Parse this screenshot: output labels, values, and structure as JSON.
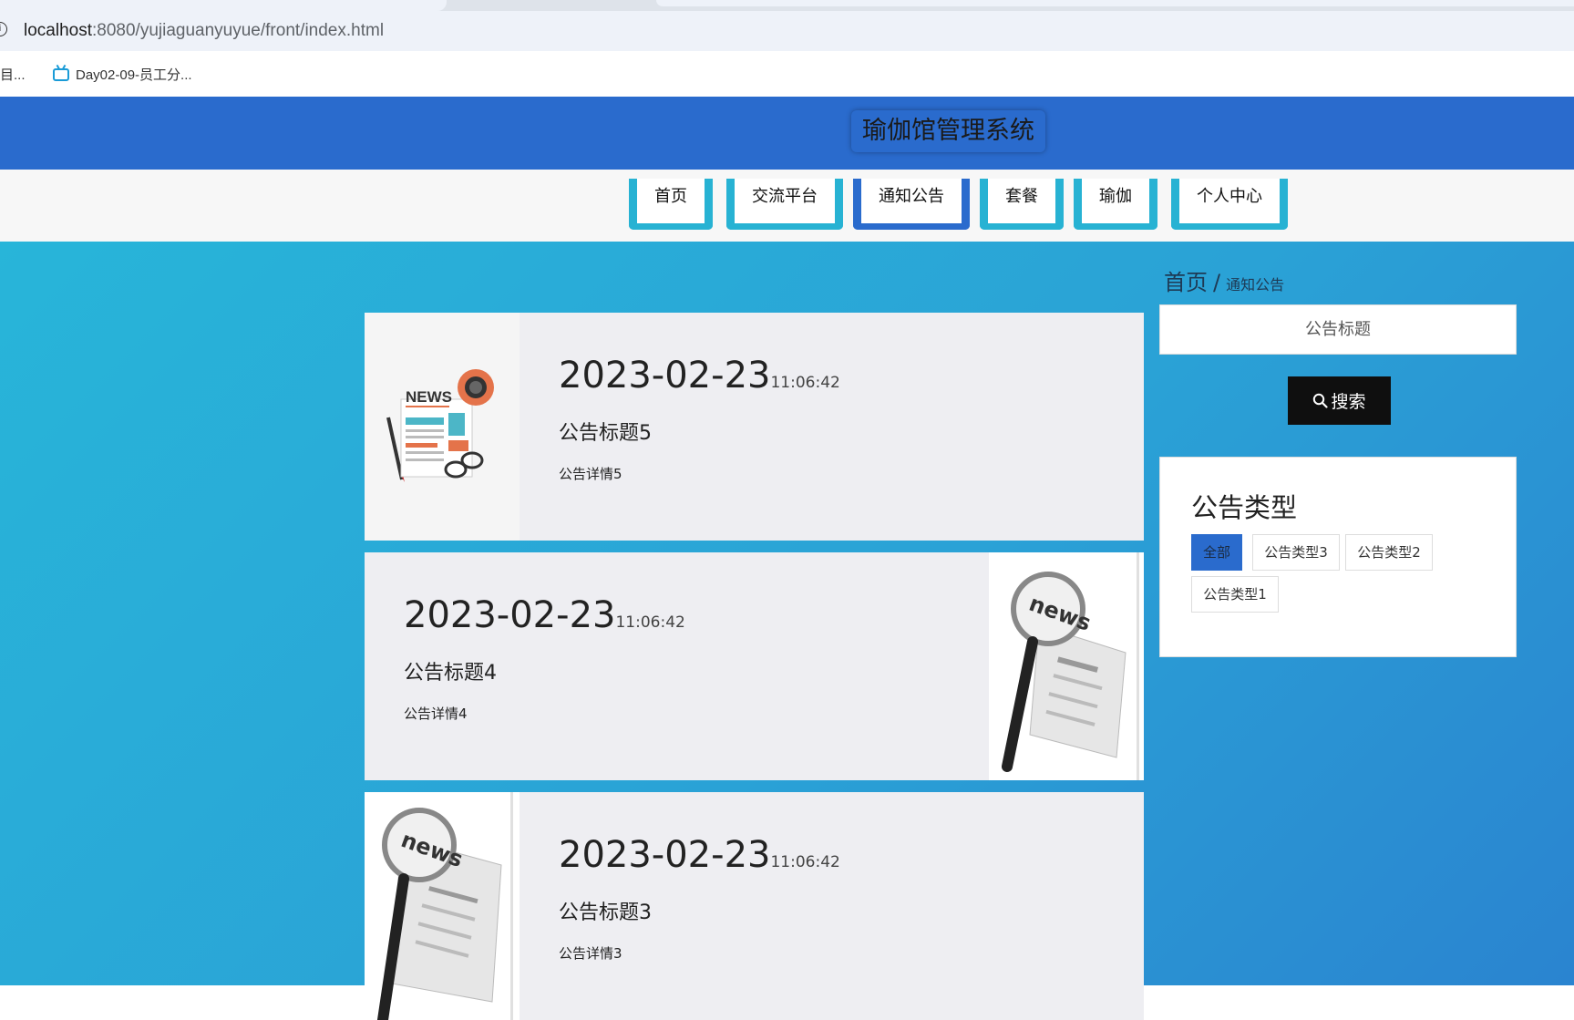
{
  "browser": {
    "url_host": "localhost",
    "url_path": ":8080/yujiaguanyuyue/front/index.html",
    "bookmarks": [
      {
        "label": "目..."
      },
      {
        "label": "Day02-09-员工分..."
      }
    ]
  },
  "header": {
    "title": "瑜伽馆管理系统"
  },
  "nav": {
    "items": [
      {
        "label": "首页"
      },
      {
        "label": "交流平台"
      },
      {
        "label": "通知公告"
      },
      {
        "label": "套餐"
      },
      {
        "label": "瑜伽"
      },
      {
        "label": "个人中心"
      }
    ],
    "active_index": 2
  },
  "breadcrumb": {
    "home": "首页",
    "sep": "/",
    "current": "通知公告"
  },
  "search": {
    "placeholder": "公告标题",
    "button_label": "搜索"
  },
  "types": {
    "title": "公告类型",
    "items": [
      {
        "label": "全部",
        "active": true
      },
      {
        "label": "公告类型3"
      },
      {
        "label": "公告类型2"
      },
      {
        "label": "公告类型1"
      }
    ]
  },
  "notices": [
    {
      "date": "2023-02-23",
      "time": "11:06:42",
      "title": "公告标题5",
      "detail": "公告详情5",
      "image": "news-paper-icon",
      "image_side": "left"
    },
    {
      "date": "2023-02-23",
      "time": "11:06:42",
      "title": "公告标题4",
      "detail": "公告详情4",
      "image": "magnifier-news-icon",
      "image_side": "right"
    },
    {
      "date": "2023-02-23",
      "time": "11:06:42",
      "title": "公告标题3",
      "detail": "公告详情3",
      "image": "magnifier-news-icon",
      "image_side": "left"
    }
  ],
  "colors": {
    "header_blue": "#2a6bcd",
    "nav_cyan": "#27b2d3",
    "card_bg": "#eeeef2"
  }
}
